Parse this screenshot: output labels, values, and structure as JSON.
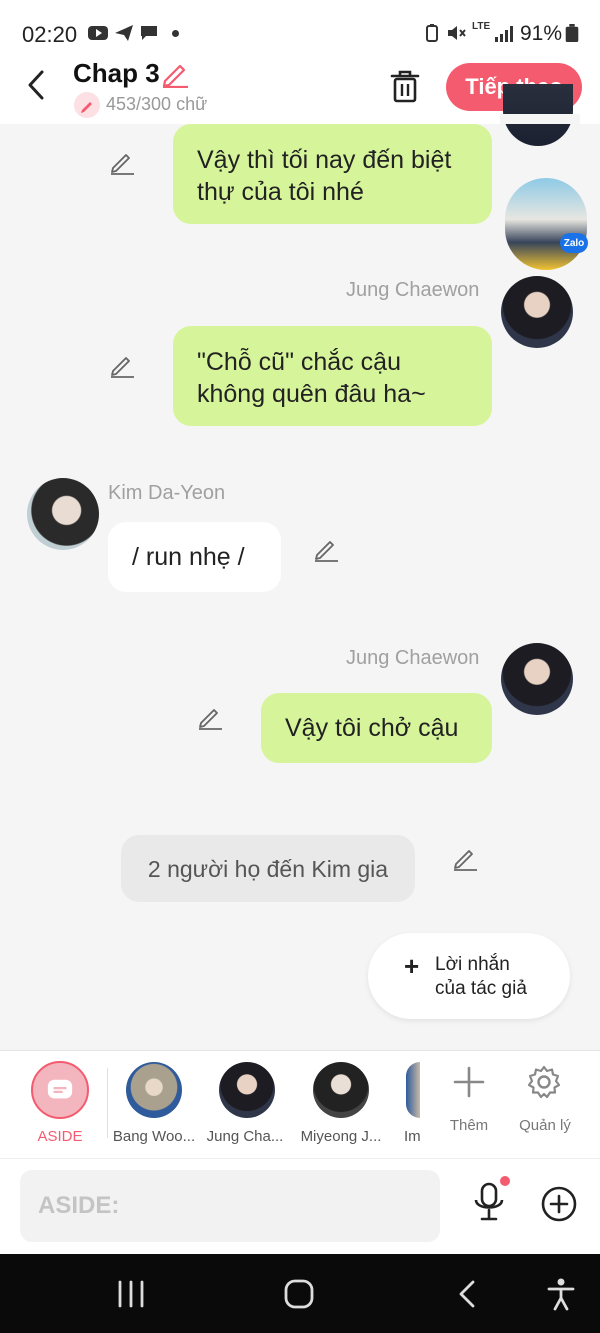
{
  "status_bar": {
    "time": "02:20",
    "battery": "91%",
    "network": "LTE"
  },
  "header": {
    "title": "Chap 3",
    "word_count": "453/300 chữ",
    "next_label": "Tiếp theo"
  },
  "messages": [
    {
      "type": "right",
      "text": "Vậy thì tối nay đến biệt thự của tôi nhé"
    },
    {
      "type": "right",
      "speaker": "Jung Chaewon",
      "text": "\"Chỗ cũ\" chắc cậu không quên đâu ha~"
    },
    {
      "type": "left",
      "speaker": "Kim Da-Yeon",
      "text": "/ run nhẹ /"
    },
    {
      "type": "right",
      "speaker": "Jung Chaewon",
      "text": "Vậy tôi chở cậu"
    },
    {
      "type": "aside",
      "text": "2 người họ đến Kim gia"
    }
  ],
  "author_note": {
    "line1": "Lời nhắn",
    "line2": "của tác giả"
  },
  "avatar_badge": "Zalo",
  "characters": [
    {
      "label": "ASIDE",
      "active": true
    },
    {
      "label": "Bang Woo..."
    },
    {
      "label": "Jung Cha..."
    },
    {
      "label": "Miyeong J..."
    },
    {
      "label": "Im"
    }
  ],
  "char_actions": {
    "add": "Thêm",
    "manage": "Quản lý"
  },
  "input": {
    "placeholder": "ASIDE:"
  },
  "colors": {
    "accent": "#f45b6f",
    "bubble_green": "#d6f49a",
    "background": "#f5f5f5"
  }
}
